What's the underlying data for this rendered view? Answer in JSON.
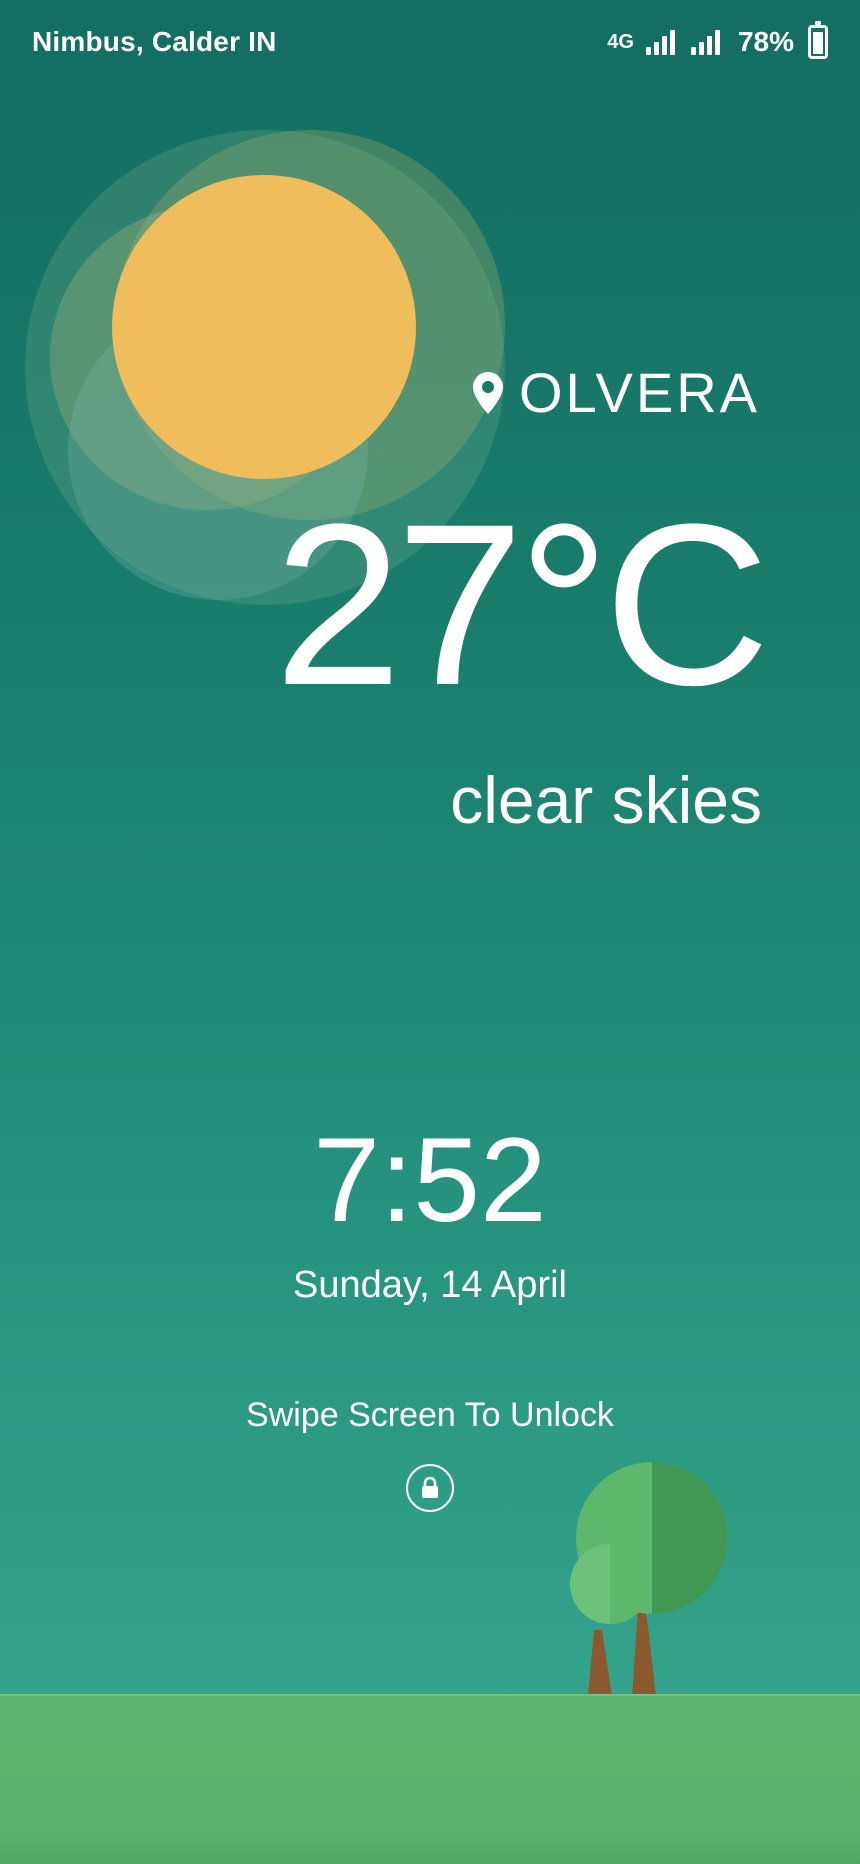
{
  "status_bar": {
    "carrier": "Nimbus, Calder IN",
    "network_type": "4G",
    "battery_percent": "78%",
    "battery_level": 0.78
  },
  "weather": {
    "location": "OLVERA",
    "temperature": "27°C",
    "condition": "clear skies",
    "icon": "sun-icon",
    "sun_color": "#efbd5b"
  },
  "lockscreen": {
    "time": "7:52",
    "date": "Sunday, 14 April",
    "unlock_hint": "Swipe Screen To Unlock",
    "lock_icon": "lock-icon"
  },
  "colors": {
    "background_top": "#146e61",
    "background_bottom": "#3aa68c",
    "ground": "#5bb46d",
    "tree_light": "#5cb86a",
    "tree_dark": "#3f9955",
    "trunk": "#8a5a2e"
  }
}
